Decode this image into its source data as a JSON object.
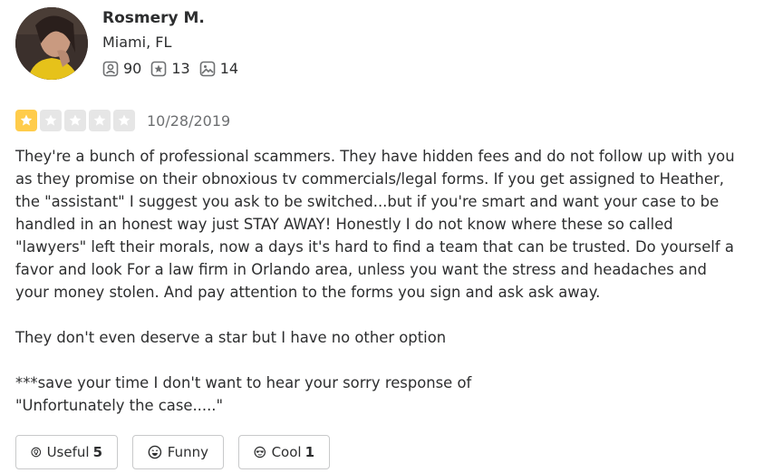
{
  "user": {
    "name": "Rosmery M.",
    "location": "Miami, FL",
    "stats": {
      "friends": "90",
      "reviews": "13",
      "photos": "14"
    },
    "icons": {
      "friends": "friends-icon",
      "reviews": "star-badge-icon",
      "photos": "photo-icon"
    }
  },
  "review": {
    "rating": 1,
    "max_rating": 5,
    "star_color": "#ffcc4b",
    "empty_star_color": "#e6e6e6",
    "date": "10/28/2019",
    "lines": [
      "They're a bunch of professional scammers. They have hidden fees and do not follow up with you",
      "as they promise on their obnoxious tv commercials/legal forms. If you get assigned to Heather,",
      "the \"assistant\" I suggest you ask to be switched...but if you're smart and want your case to be",
      "handled in an honest way just STAY AWAY! Honestly I do not know where these so called",
      "\"lawyers\" left their morals, now a days it's hard to find a team that can be trusted. Do yourself a",
      "favor and look For a law firm in Orlando area, unless you want the stress and headaches and",
      "your money stolen. And pay attention to the forms you sign and ask ask away.",
      "",
      "They don't even deserve a star but I have no other option",
      "",
      "***save your time I don't want to hear your sorry response of",
      "\"Unfortunately the case.....\""
    ]
  },
  "actions": {
    "useful": {
      "label": "Useful",
      "count": "5",
      "icon": "lightbulb-icon"
    },
    "funny": {
      "label": "Funny",
      "count": "",
      "icon": "laugh-icon"
    },
    "cool": {
      "label": "Cool",
      "count": "1",
      "icon": "sunglasses-icon"
    }
  }
}
